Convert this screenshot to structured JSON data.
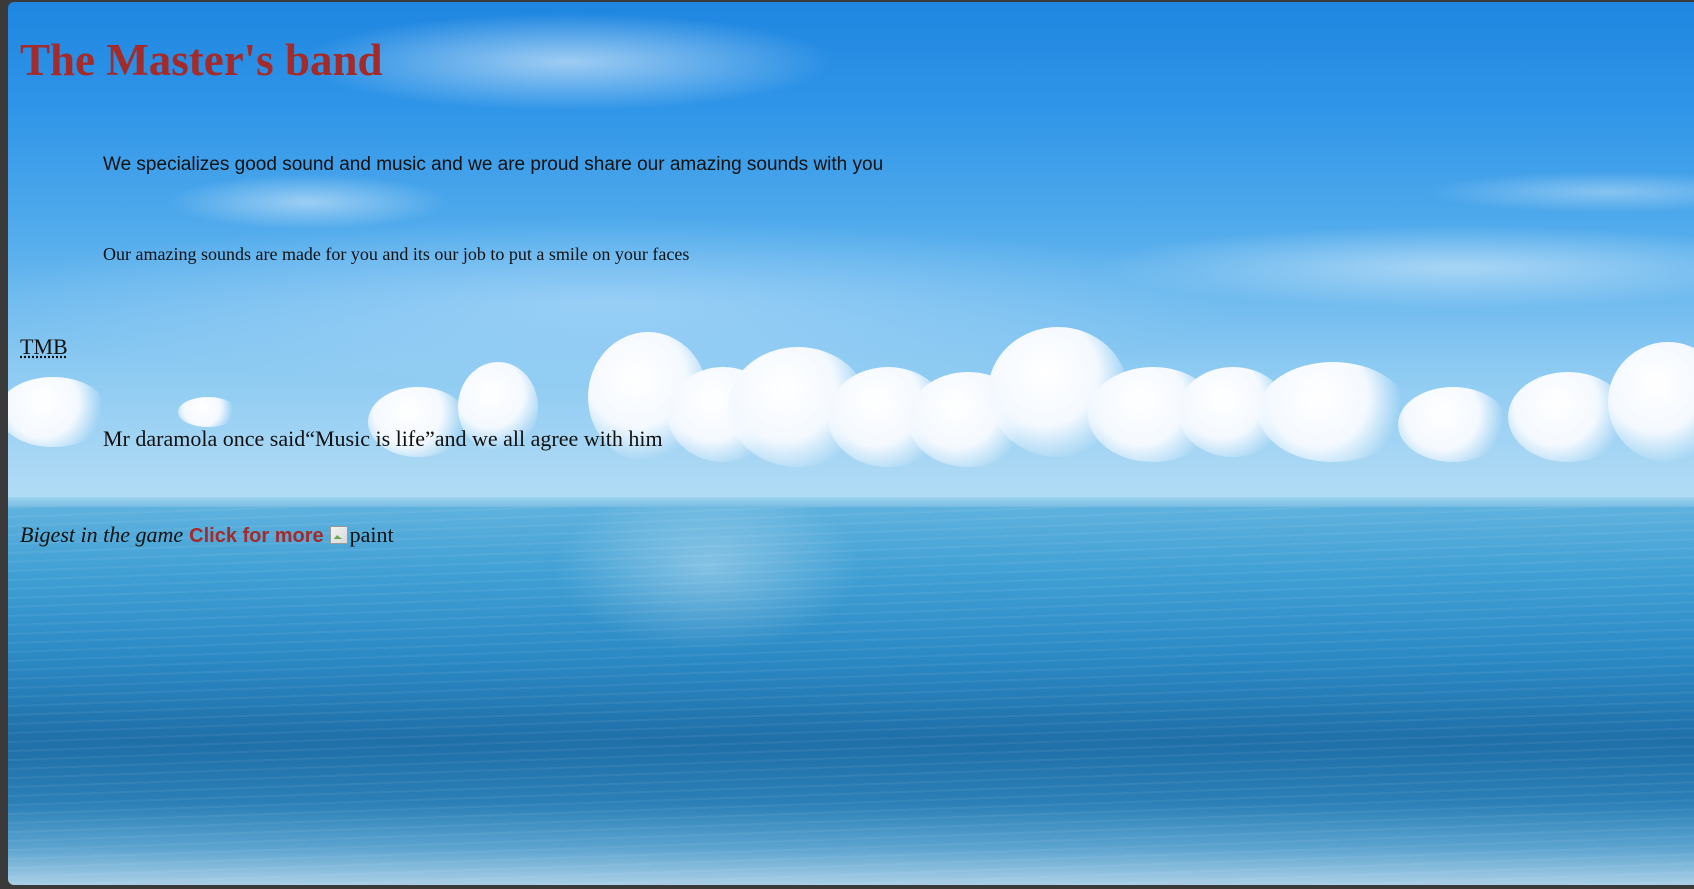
{
  "page": {
    "title": "The Master's band",
    "intro_sans": "We specializes good sound and music and we are proud share our amazing sounds with you",
    "intro_serif": "Our amazing sounds are made for you and its our job to put a smile on your faces",
    "abbreviation": "TMB",
    "quote_line": "Mr daramola once said“Music is life”and we all agree with him",
    "tagline": "Bigest in the game",
    "link_label": "Click for more",
    "image_alt": "paint"
  },
  "colors": {
    "title": "#a52a2a",
    "link": "#a52a2a",
    "body_text": "#111111"
  }
}
